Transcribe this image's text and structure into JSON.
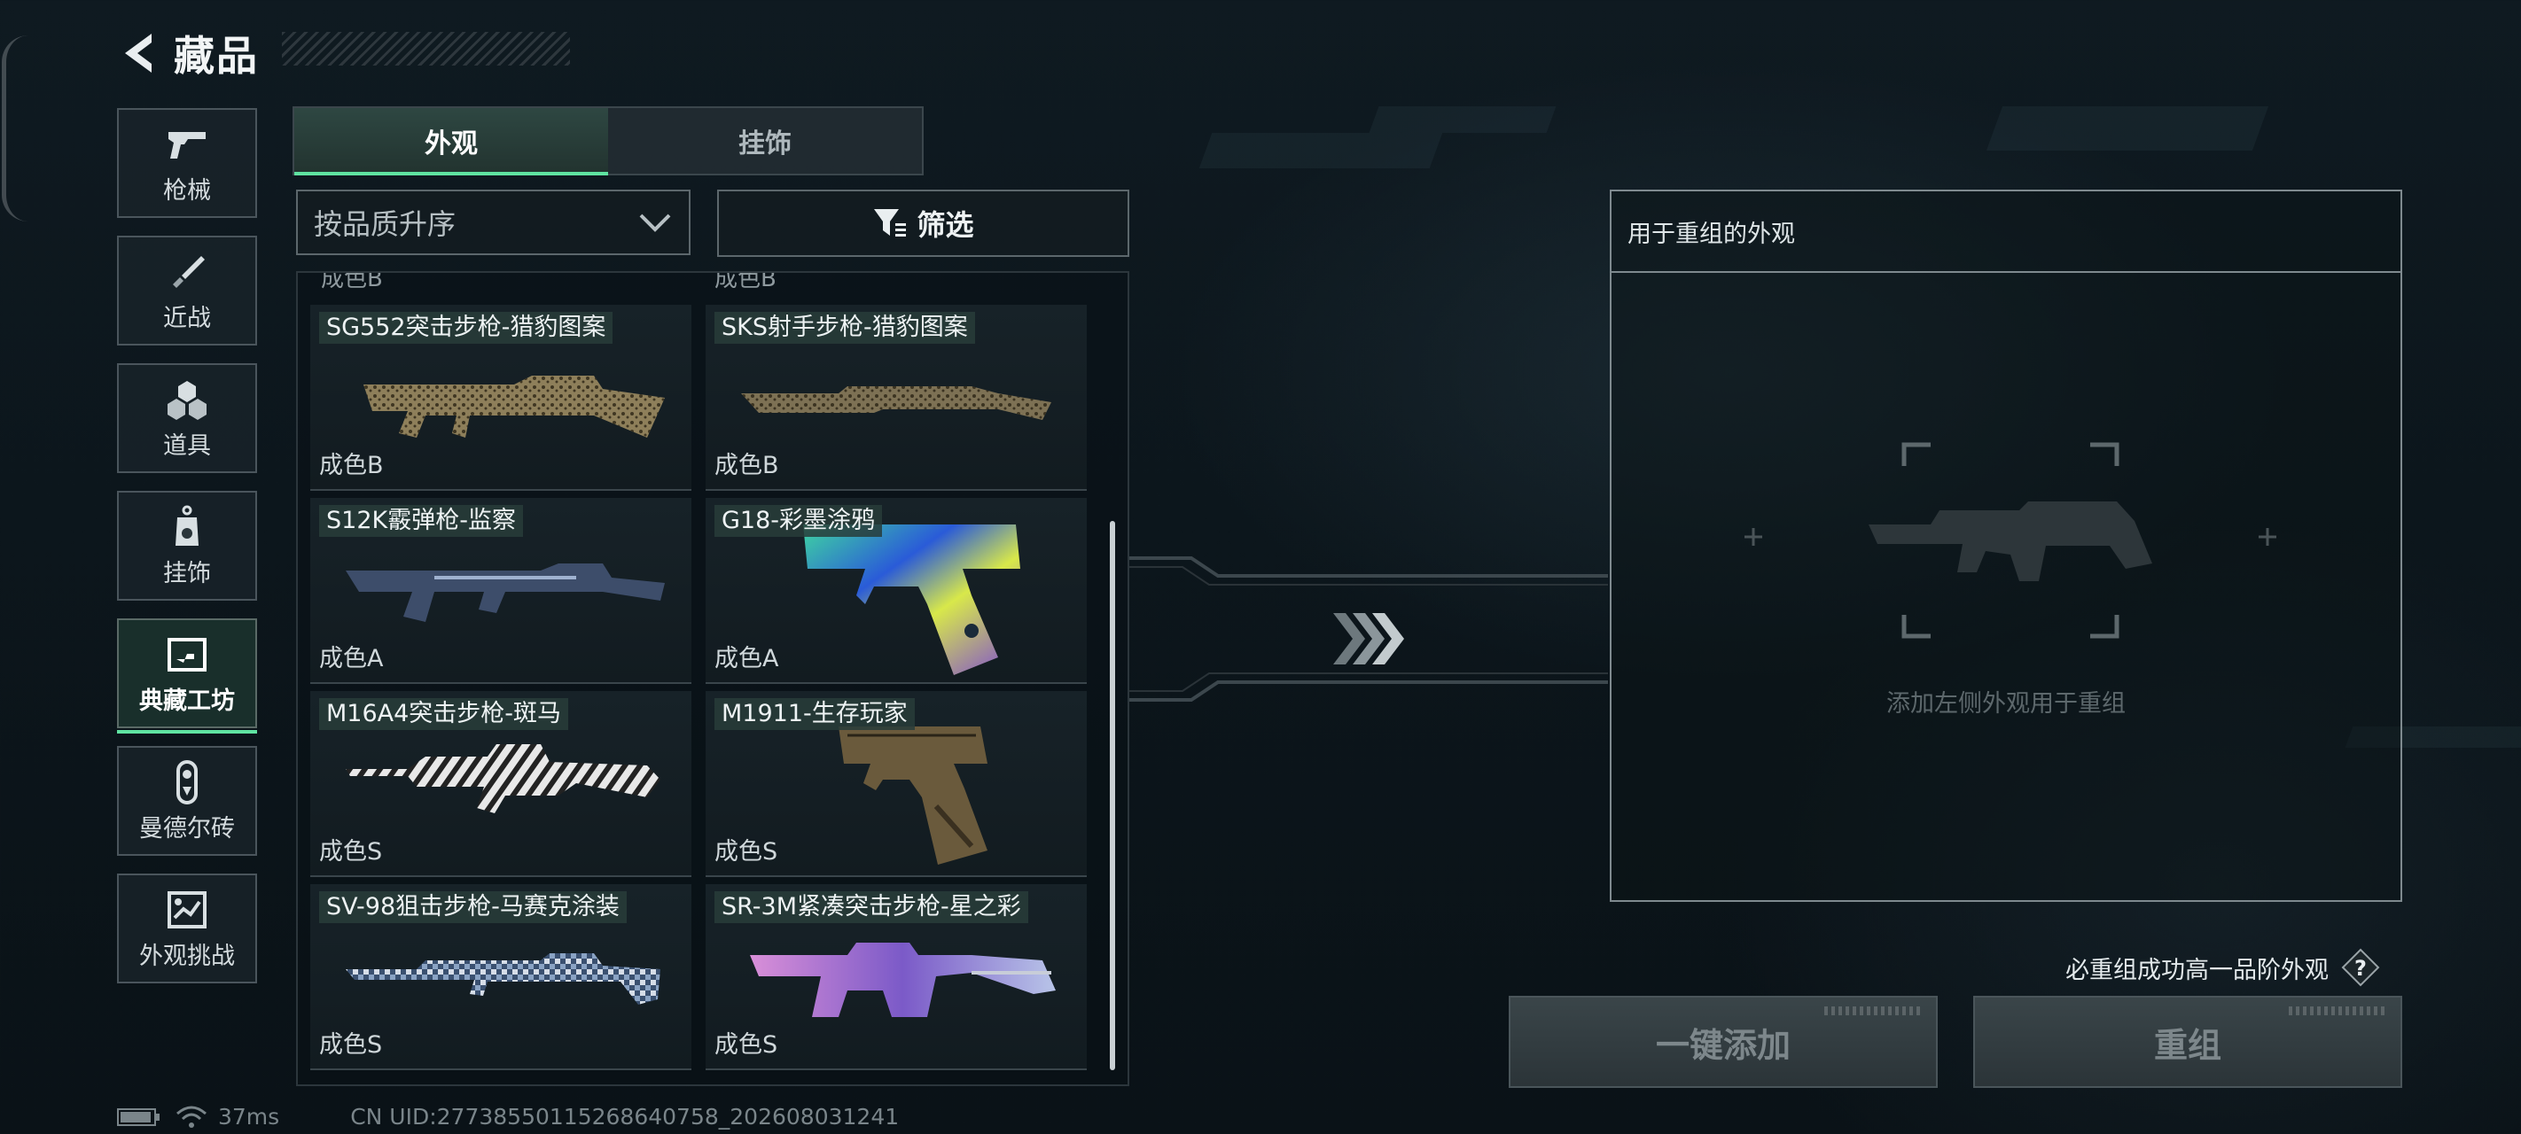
{
  "header": {
    "title": "藏品"
  },
  "sidebar": {
    "items": [
      {
        "label": "枪械",
        "icon": "pistol-icon"
      },
      {
        "label": "近战",
        "icon": "knife-icon"
      },
      {
        "label": "道具",
        "icon": "grenade-icon"
      },
      {
        "label": "挂饰",
        "icon": "charm-tag-icon"
      },
      {
        "label": "典藏工坊",
        "icon": "workshop-icon",
        "active": true
      },
      {
        "label": "曼德尔砖",
        "icon": "mandel-brick-icon"
      },
      {
        "label": "外观挑战",
        "icon": "challenge-map-icon"
      }
    ]
  },
  "tabs": [
    {
      "label": "外观",
      "active": true
    },
    {
      "label": "挂饰",
      "active": false
    }
  ],
  "sort": {
    "label": "按品质升序"
  },
  "filter": {
    "label": "筛选"
  },
  "grid": {
    "partial_top_labels": [
      "成色B",
      "成色B"
    ],
    "items": [
      {
        "name": "SG552突击步枪-猎豹图案",
        "grade": "成色B",
        "icon": "rifle-leopard-skin-icon"
      },
      {
        "name": "SKS射手步枪-猎豹图案",
        "grade": "成色B",
        "icon": "marksman-rifle-leopard-skin-icon"
      },
      {
        "name": "S12K霰弹枪-监察",
        "grade": "成色A",
        "icon": "shotgun-skin-icon"
      },
      {
        "name": "G18-彩墨涂鸦",
        "grade": "成色A",
        "icon": "pistol-graffiti-skin-icon"
      },
      {
        "name": "M16A4突击步枪-斑马",
        "grade": "成色S",
        "icon": "rifle-zebra-skin-icon"
      },
      {
        "name": "M1911-生存玩家",
        "grade": "成色S",
        "icon": "pistol-survivor-skin-icon"
      },
      {
        "name": "SV-98狙击步枪-马赛克涂装",
        "grade": "成色S",
        "icon": "sniper-mosaic-skin-icon"
      },
      {
        "name": "SR-3M紧凑突击步枪-星之彩",
        "grade": "成色S",
        "icon": "compact-rifle-star-skin-icon"
      }
    ]
  },
  "recombine": {
    "header": "用于重组的外观",
    "placeholder": "添加左侧外观用于重组",
    "guarantee_note": "必重组成功高一品阶外观",
    "auto_add_label": "一键添加",
    "recombine_label": "重组"
  },
  "status": {
    "ping": "37ms",
    "uid": "CN UID:2773855011526864075​8_202608031241"
  }
}
